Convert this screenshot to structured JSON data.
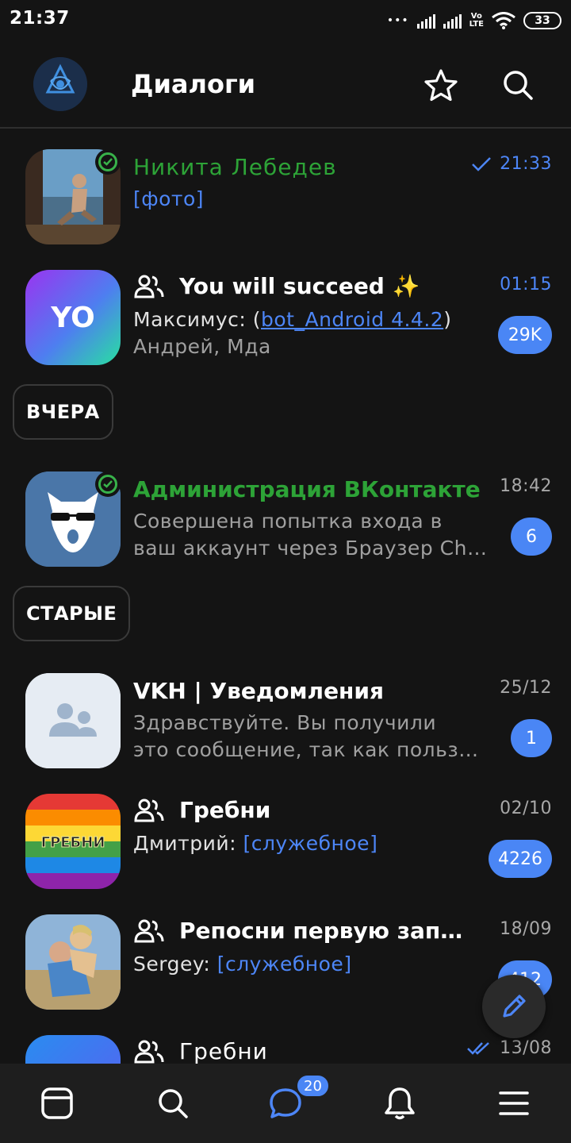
{
  "status_bar": {
    "time": "21:37",
    "dots": "•••",
    "volte": "Vo LTE",
    "battery": "33"
  },
  "header": {
    "title": "Диалоги"
  },
  "dialogs": [
    {
      "name": "Никита Лебедев",
      "preview": "[фото]",
      "time": "21:33",
      "read": true,
      "online": true
    },
    {
      "name": "You will succeed",
      "emoji": "✨",
      "avatar_text": "YO",
      "sender": "Максимус:",
      "open_paren": " (",
      "link": "bot_Android 4.4.2",
      "close_paren": ")",
      "line2": "Андрей, Мда",
      "time": "01:15",
      "badge": "29K",
      "group": true
    },
    {
      "name": "Администрация ВКонтакте",
      "line1": "Совершена попытка входа в",
      "line2": "ваш аккаунт через Браузер Chrome",
      "time": "18:42",
      "badge": "6",
      "online": true,
      "verified_green": true
    },
    {
      "name": "VKH | Уведомления",
      "line1": "Здравствуйте. Вы получили",
      "line2": "это сообщение, так как пользуетесь",
      "time": "25/12",
      "badge": "1"
    },
    {
      "name": "Гребни",
      "avatar_text": "ГРЕБНИ",
      "sender": "Дмитрий:",
      "preview": "[служебное]",
      "time": "02/10",
      "badge": "4226",
      "group": true
    },
    {
      "name": "Репосни первую запись",
      "sender": "Sergey:",
      "preview": "[служебное]",
      "time": "18/09",
      "badge": "412",
      "group": true
    },
    {
      "name": "Гребни",
      "time": "13/08",
      "read": true,
      "group": true
    }
  ],
  "sections": {
    "yesterday": "ВЧЕРА",
    "older": "СТАРЫЕ"
  },
  "bottom_nav": {
    "messages_badge": "20",
    "items": [
      "feed-icon",
      "search-icon",
      "messages-icon",
      "notifications-icon",
      "menu-icon"
    ]
  },
  "colors": {
    "background": "#141414",
    "accent": "#4a86f5",
    "online_green": "#38b24a",
    "name_green": "#2da337"
  }
}
